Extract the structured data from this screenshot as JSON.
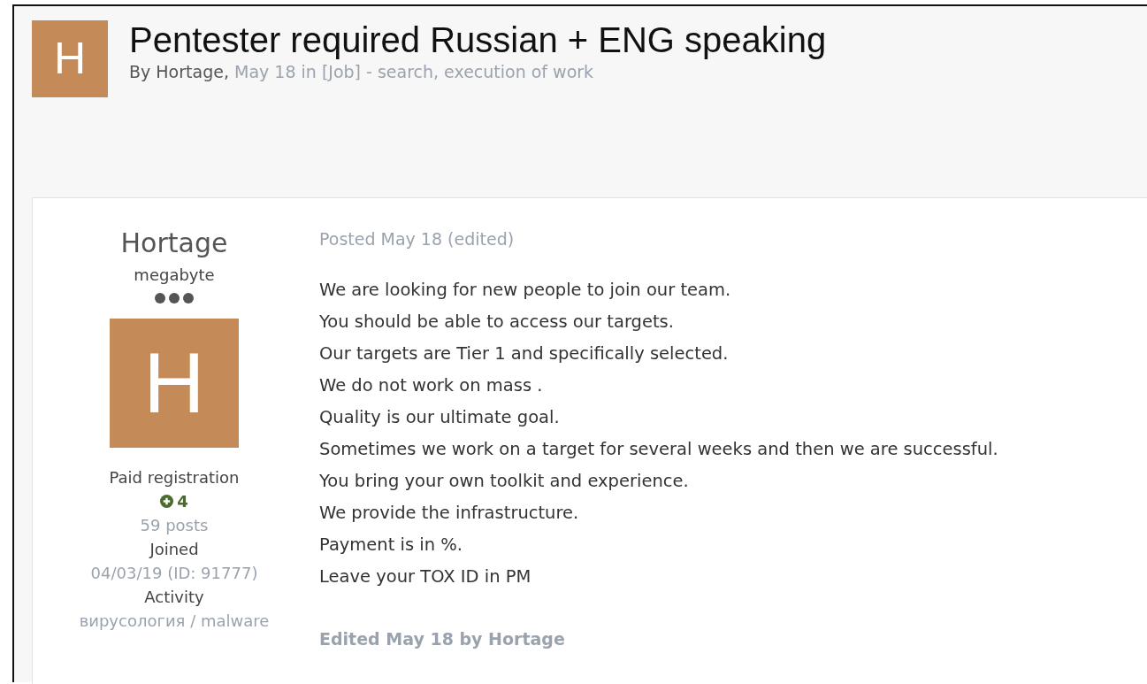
{
  "topic": {
    "avatar_letter": "H",
    "title": "Pentester required Russian + ENG speaking",
    "by_label": "By",
    "author": "Hortage,",
    "meta": "May 18 in [Job] - search, execution of work"
  },
  "author_panel": {
    "name": "Hortage",
    "rank": "megabyte",
    "avatar_letter": "H",
    "group": "Paid registration",
    "reputation": "4",
    "posts": "59 posts",
    "joined_label": "Joined",
    "joined": "04/03/19 (ID: 91777)",
    "activity_label": "Activity",
    "activity": "вирусология / malware"
  },
  "post": {
    "posted": "Posted May 18 (edited)",
    "lines": [
      "We are looking for new people to join our team.",
      "You should be able to access our targets.",
      "Our targets are Tier 1 and specifically selected.",
      "We do not work on mass .",
      "Quality is our ultimate goal.",
      "Sometimes we work on a target for several weeks and then we are successful.",
      "You bring your own toolkit and experience.",
      "We provide the infrastructure.",
      "Payment is in %.",
      "Leave your TOX ID in PM"
    ],
    "edited": "Edited May 18 by Hortage"
  }
}
